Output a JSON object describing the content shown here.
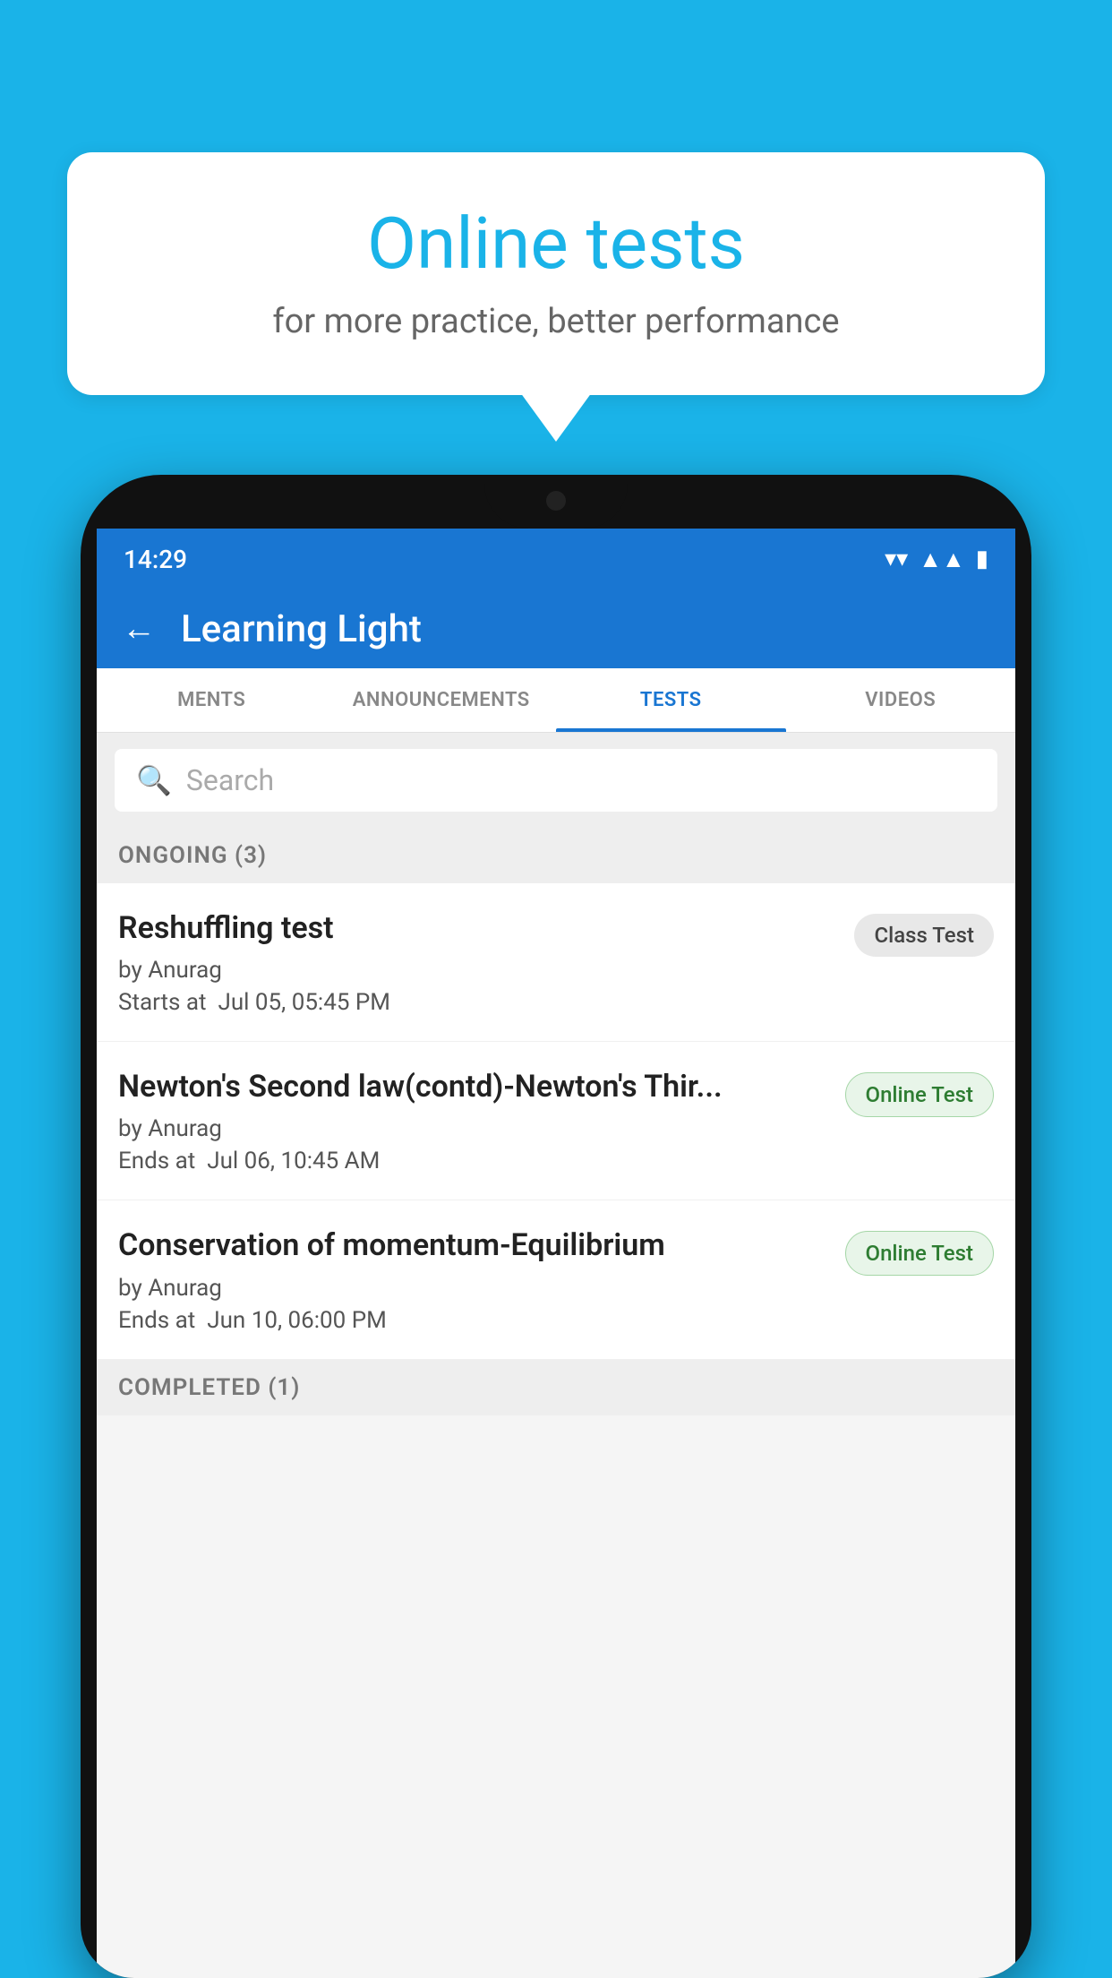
{
  "background_color": "#1ab3e8",
  "bubble": {
    "title": "Online tests",
    "subtitle": "for more practice, better performance"
  },
  "phone": {
    "status_bar": {
      "time": "14:29",
      "wifi": "▼",
      "signal": "▲",
      "battery": "▮"
    },
    "header": {
      "back_label": "←",
      "title": "Learning Light"
    },
    "tabs": [
      {
        "label": "MENTS",
        "active": false
      },
      {
        "label": "ANNOUNCEMENTS",
        "active": false
      },
      {
        "label": "TESTS",
        "active": true
      },
      {
        "label": "VIDEOS",
        "active": false
      }
    ],
    "search": {
      "placeholder": "Search"
    },
    "ongoing_section": {
      "label": "ONGOING (3)"
    },
    "tests": [
      {
        "name": "Reshuffling test",
        "author": "by Anurag",
        "time_label": "Starts at",
        "time": "Jul 05, 05:45 PM",
        "badge": "Class Test",
        "badge_type": "class"
      },
      {
        "name": "Newton's Second law(contd)-Newton's Thir...",
        "author": "by Anurag",
        "time_label": "Ends at",
        "time": "Jul 06, 10:45 AM",
        "badge": "Online Test",
        "badge_type": "online"
      },
      {
        "name": "Conservation of momentum-Equilibrium",
        "author": "by Anurag",
        "time_label": "Ends at",
        "time": "Jun 10, 06:00 PM",
        "badge": "Online Test",
        "badge_type": "online"
      }
    ],
    "completed_section": {
      "label": "COMPLETED (1)"
    }
  }
}
